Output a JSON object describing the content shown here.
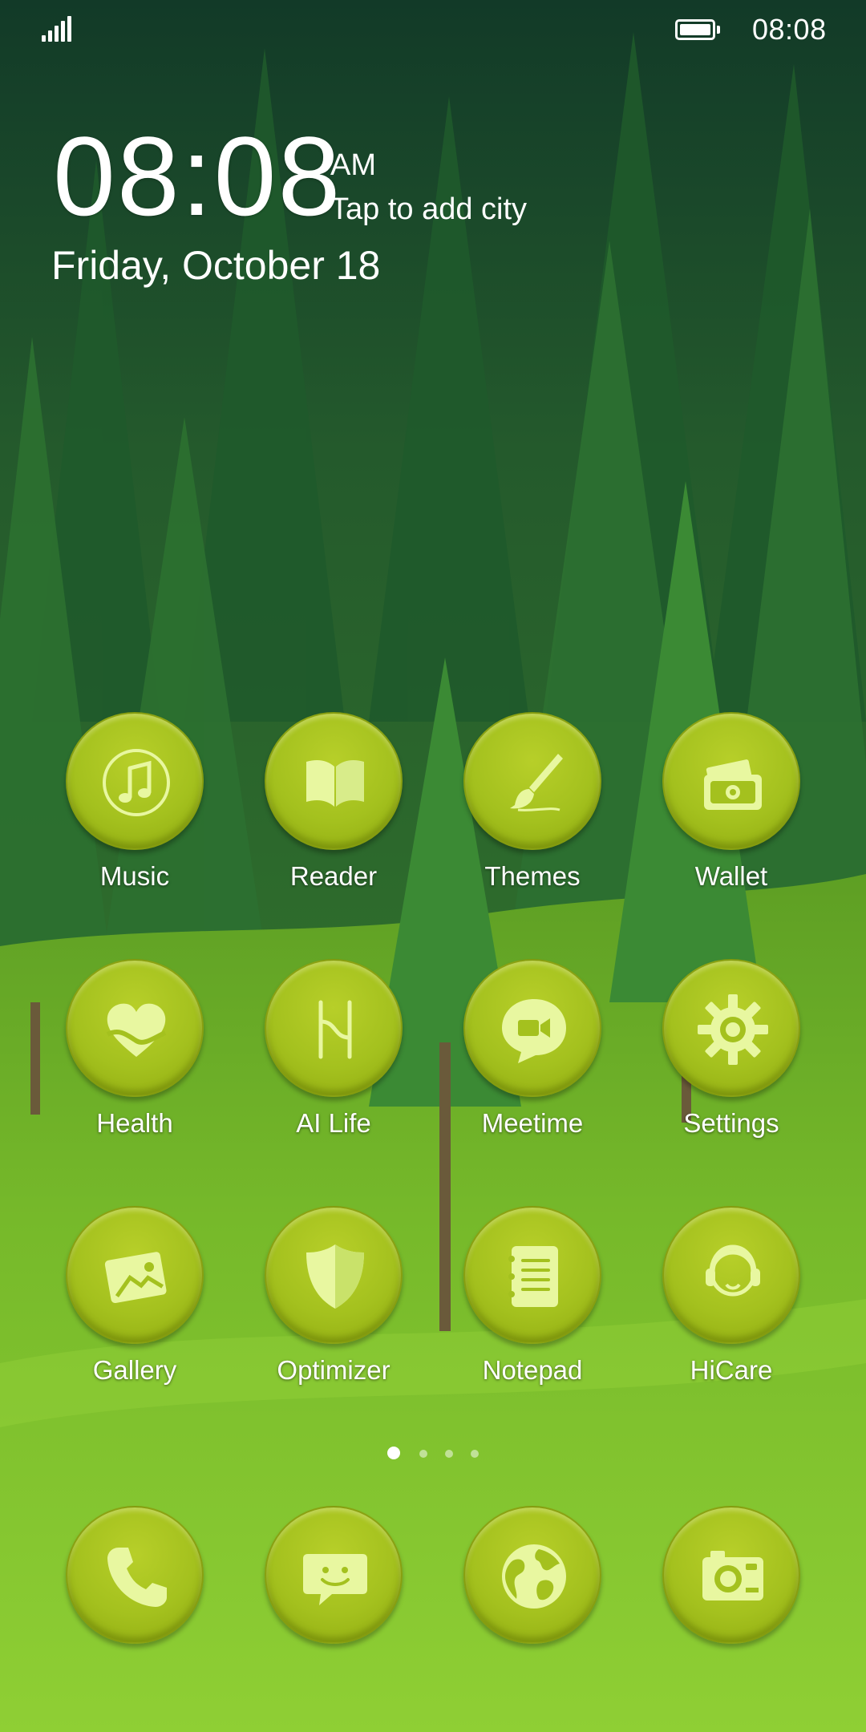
{
  "status_bar": {
    "time": "08:08",
    "signal_icon": "signal-icon",
    "battery_icon": "battery-icon"
  },
  "clock": {
    "time": "08:08",
    "ampm": "AM",
    "city_prompt": "Tap to add city",
    "date": "Friday, October 18"
  },
  "icon_color": "#a4c11e",
  "glyph_color": "#e8f7a0",
  "apps": [
    {
      "label": "Music",
      "icon": "music-note-icon"
    },
    {
      "label": "Reader",
      "icon": "book-icon"
    },
    {
      "label": "Themes",
      "icon": "paintbrush-icon"
    },
    {
      "label": "Wallet",
      "icon": "wallet-icon"
    },
    {
      "label": "Health",
      "icon": "heart-icon"
    },
    {
      "label": "AI Life",
      "icon": "ai-life-icon"
    },
    {
      "label": "Meetime",
      "icon": "video-chat-icon"
    },
    {
      "label": "Settings",
      "icon": "gear-icon"
    },
    {
      "label": "Gallery",
      "icon": "photo-icon"
    },
    {
      "label": "Optimizer",
      "icon": "shield-icon"
    },
    {
      "label": "Notepad",
      "icon": "notepad-icon"
    },
    {
      "label": "HiCare",
      "icon": "headset-icon"
    }
  ],
  "page_indicator": {
    "count": 4,
    "active": 1
  },
  "dock": [
    {
      "icon": "phone-icon"
    },
    {
      "icon": "messages-icon"
    },
    {
      "icon": "browser-globe-icon"
    },
    {
      "icon": "camera-icon"
    }
  ]
}
